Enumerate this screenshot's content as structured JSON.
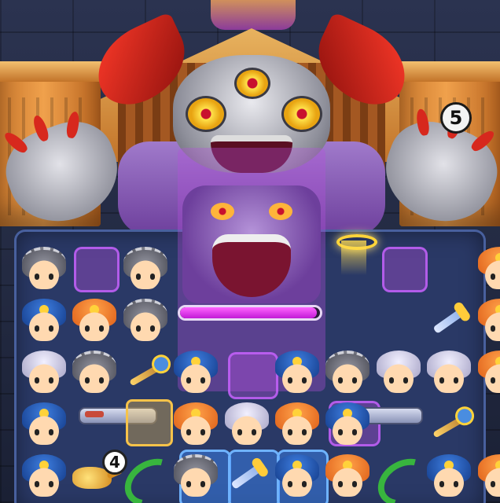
{
  "game": {
    "turn_counter": "5",
    "boss_hp_fraction": 0.98,
    "lamp_counter": "4"
  },
  "tiles": [
    {
      "type": "t-knight",
      "kind": "hero",
      "row": 0,
      "col": 0
    },
    {
      "type": "t-knight",
      "kind": "hero",
      "row": 0,
      "col": 2
    },
    {
      "type": "t-orange",
      "kind": "hero",
      "row": 0,
      "col": 9
    },
    {
      "type": "t-blue",
      "kind": "hero",
      "row": 1,
      "col": 0
    },
    {
      "type": "t-orange",
      "kind": "hero",
      "row": 1,
      "col": 1
    },
    {
      "type": "t-knight",
      "kind": "hero",
      "row": 1,
      "col": 2
    },
    {
      "type": "sword",
      "kind": "item",
      "row": 1,
      "col": 8
    },
    {
      "type": "t-orange",
      "kind": "hero",
      "row": 1,
      "col": 9
    },
    {
      "type": "t-white",
      "kind": "hero",
      "row": 2,
      "col": 0
    },
    {
      "type": "t-knight",
      "kind": "hero",
      "row": 2,
      "col": 1
    },
    {
      "type": "staff",
      "kind": "item",
      "row": 2,
      "col": 2
    },
    {
      "type": "t-blue",
      "kind": "hero",
      "row": 2,
      "col": 3
    },
    {
      "type": "t-blue",
      "kind": "hero",
      "row": 2,
      "col": 5
    },
    {
      "type": "t-knight",
      "kind": "hero",
      "row": 2,
      "col": 6
    },
    {
      "type": "t-white",
      "kind": "hero",
      "row": 2,
      "col": 7
    },
    {
      "type": "t-white",
      "kind": "hero",
      "row": 2,
      "col": 8
    },
    {
      "type": "t-orange",
      "kind": "hero",
      "row": 2,
      "col": 9
    },
    {
      "type": "t-blue",
      "kind": "hero",
      "row": 3,
      "col": 0
    },
    {
      "type": "t-orange",
      "kind": "hero",
      "row": 3,
      "col": 3
    },
    {
      "type": "t-white",
      "kind": "hero",
      "row": 3,
      "col": 4
    },
    {
      "type": "t-orange",
      "kind": "hero",
      "row": 3,
      "col": 5
    },
    {
      "type": "t-blue",
      "kind": "hero",
      "row": 3,
      "col": 6
    },
    {
      "type": "staff",
      "kind": "item",
      "row": 3,
      "col": 8
    },
    {
      "type": "t-blue",
      "kind": "hero",
      "row": 4,
      "col": 0
    },
    {
      "type": "lamp",
      "kind": "item",
      "row": 4,
      "col": 1
    },
    {
      "type": "vine",
      "kind": "item",
      "row": 4,
      "col": 2
    },
    {
      "type": "t-knight",
      "kind": "hero",
      "row": 4,
      "col": 3
    },
    {
      "type": "sword",
      "kind": "item",
      "row": 4,
      "col": 4
    },
    {
      "type": "t-blue",
      "kind": "hero",
      "row": 4,
      "col": 5
    },
    {
      "type": "t-orange",
      "kind": "hero",
      "row": 4,
      "col": 6
    },
    {
      "type": "vine",
      "kind": "item",
      "row": 4,
      "col": 7
    },
    {
      "type": "t-blue",
      "kind": "hero",
      "row": 4,
      "col": 8
    },
    {
      "type": "t-orange",
      "kind": "hero",
      "row": 4,
      "col": 9
    }
  ]
}
